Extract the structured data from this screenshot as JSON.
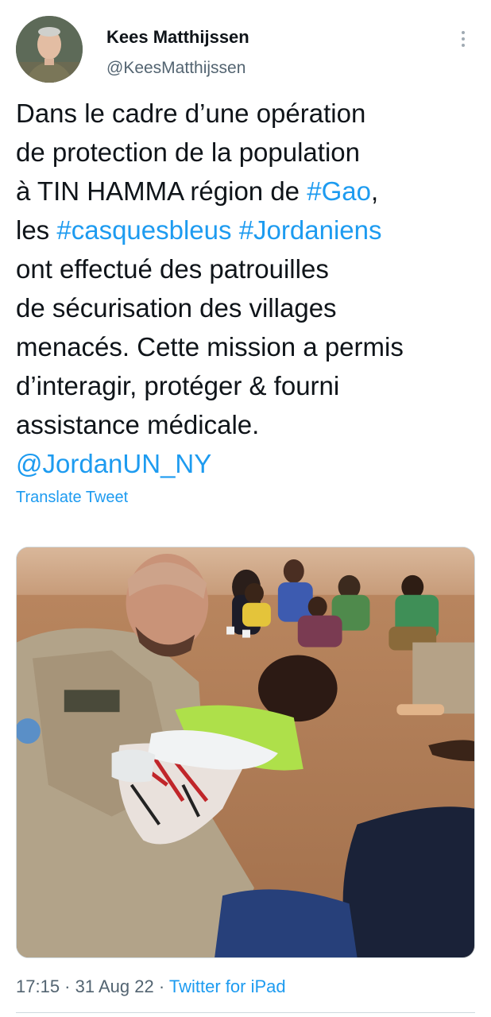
{
  "author": {
    "name": "Kees Matthijssen",
    "handle": "@KeesMatthijssen"
  },
  "tweet": {
    "lines": [
      [
        {
          "t": "Dans le cadre d’une opération"
        }
      ],
      [
        {
          "t": "de protection de la population"
        }
      ],
      [
        {
          "t": "à TIN HAMMA région de "
        },
        {
          "t": "#Gao",
          "link": true
        },
        {
          "t": ","
        }
      ],
      [
        {
          "t": "les "
        },
        {
          "t": "#casquesbleus",
          "link": true
        },
        {
          "t": " "
        },
        {
          "t": "#Jordaniens",
          "link": true
        }
      ],
      [
        {
          "t": "ont effectué des patrouilles"
        }
      ],
      [
        {
          "t": "de sécurisation des villages"
        }
      ],
      [
        {
          "t": "menacés. Cette mission a permis"
        }
      ],
      [
        {
          "t": "d’interagir, protéger & fourni"
        }
      ],
      [
        {
          "t": "assistance médicale."
        }
      ],
      [
        {
          "t": "@JordanUN_NY",
          "link": true
        }
      ]
    ],
    "translate_label": "Translate Tweet"
  },
  "meta": {
    "time": "17:15",
    "sep1": " · ",
    "date": "31 Aug 22",
    "sep2": " · ",
    "source": "Twitter for iPad"
  },
  "colors": {
    "accent": "#1d9bf0",
    "secondary_text": "#536471",
    "primary_text": "#0f1419"
  },
  "icons": {
    "more": "vertical-three-dots"
  }
}
